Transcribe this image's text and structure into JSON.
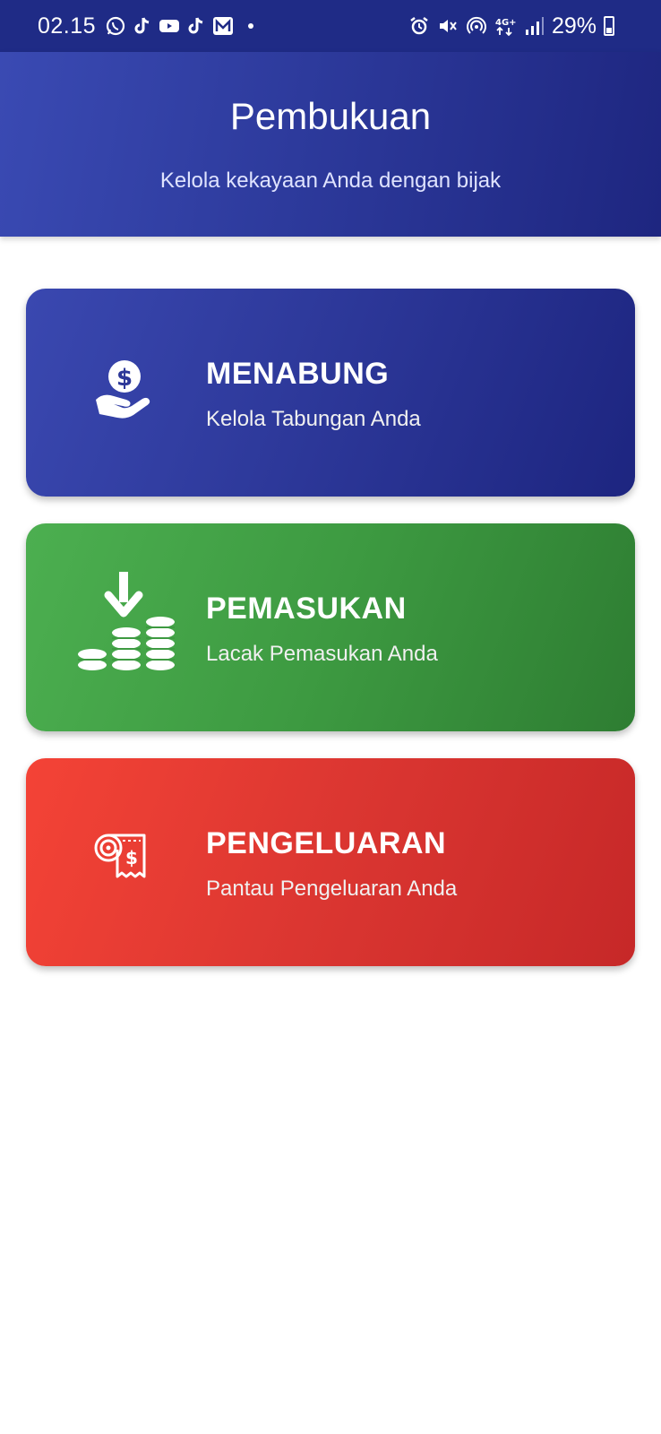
{
  "status_bar": {
    "time": "02.15",
    "battery": "29%",
    "left_icons": [
      "whatsapp-icon",
      "tiktok-icon",
      "youtube-icon",
      "tiktok-icon",
      "m-app-icon"
    ],
    "right_icons": [
      "alarm-icon",
      "mute-icon",
      "hotspot-icon",
      "network-4g-icon",
      "signal-icon",
      "battery-icon"
    ],
    "network_label": "4G+"
  },
  "header": {
    "title": "Pembukuan",
    "subtitle": "Kelola kekayaan Anda dengan bijak"
  },
  "cards": [
    {
      "title": "MENABUNG",
      "subtitle": "Kelola Tabungan Anda",
      "icon": "savings-hand-icon",
      "color_start": "#3a48b0",
      "color_end": "#1d2580"
    },
    {
      "title": "PEMASUKAN",
      "subtitle": "Lacak Pemasukan Anda",
      "icon": "income-coins-icon",
      "color_start": "#4caf50",
      "color_end": "#2e7d32"
    },
    {
      "title": "PENGELUARAN",
      "subtitle": "Pantau Pengeluaran Anda",
      "icon": "expense-receipt-icon",
      "color_start": "#f44336",
      "color_end": "#c62828"
    }
  ],
  "colors": {
    "status_bar": "#1f2b86",
    "header_start": "#3a4ab3",
    "header_end": "#1e2680",
    "background": "#ffffff"
  }
}
